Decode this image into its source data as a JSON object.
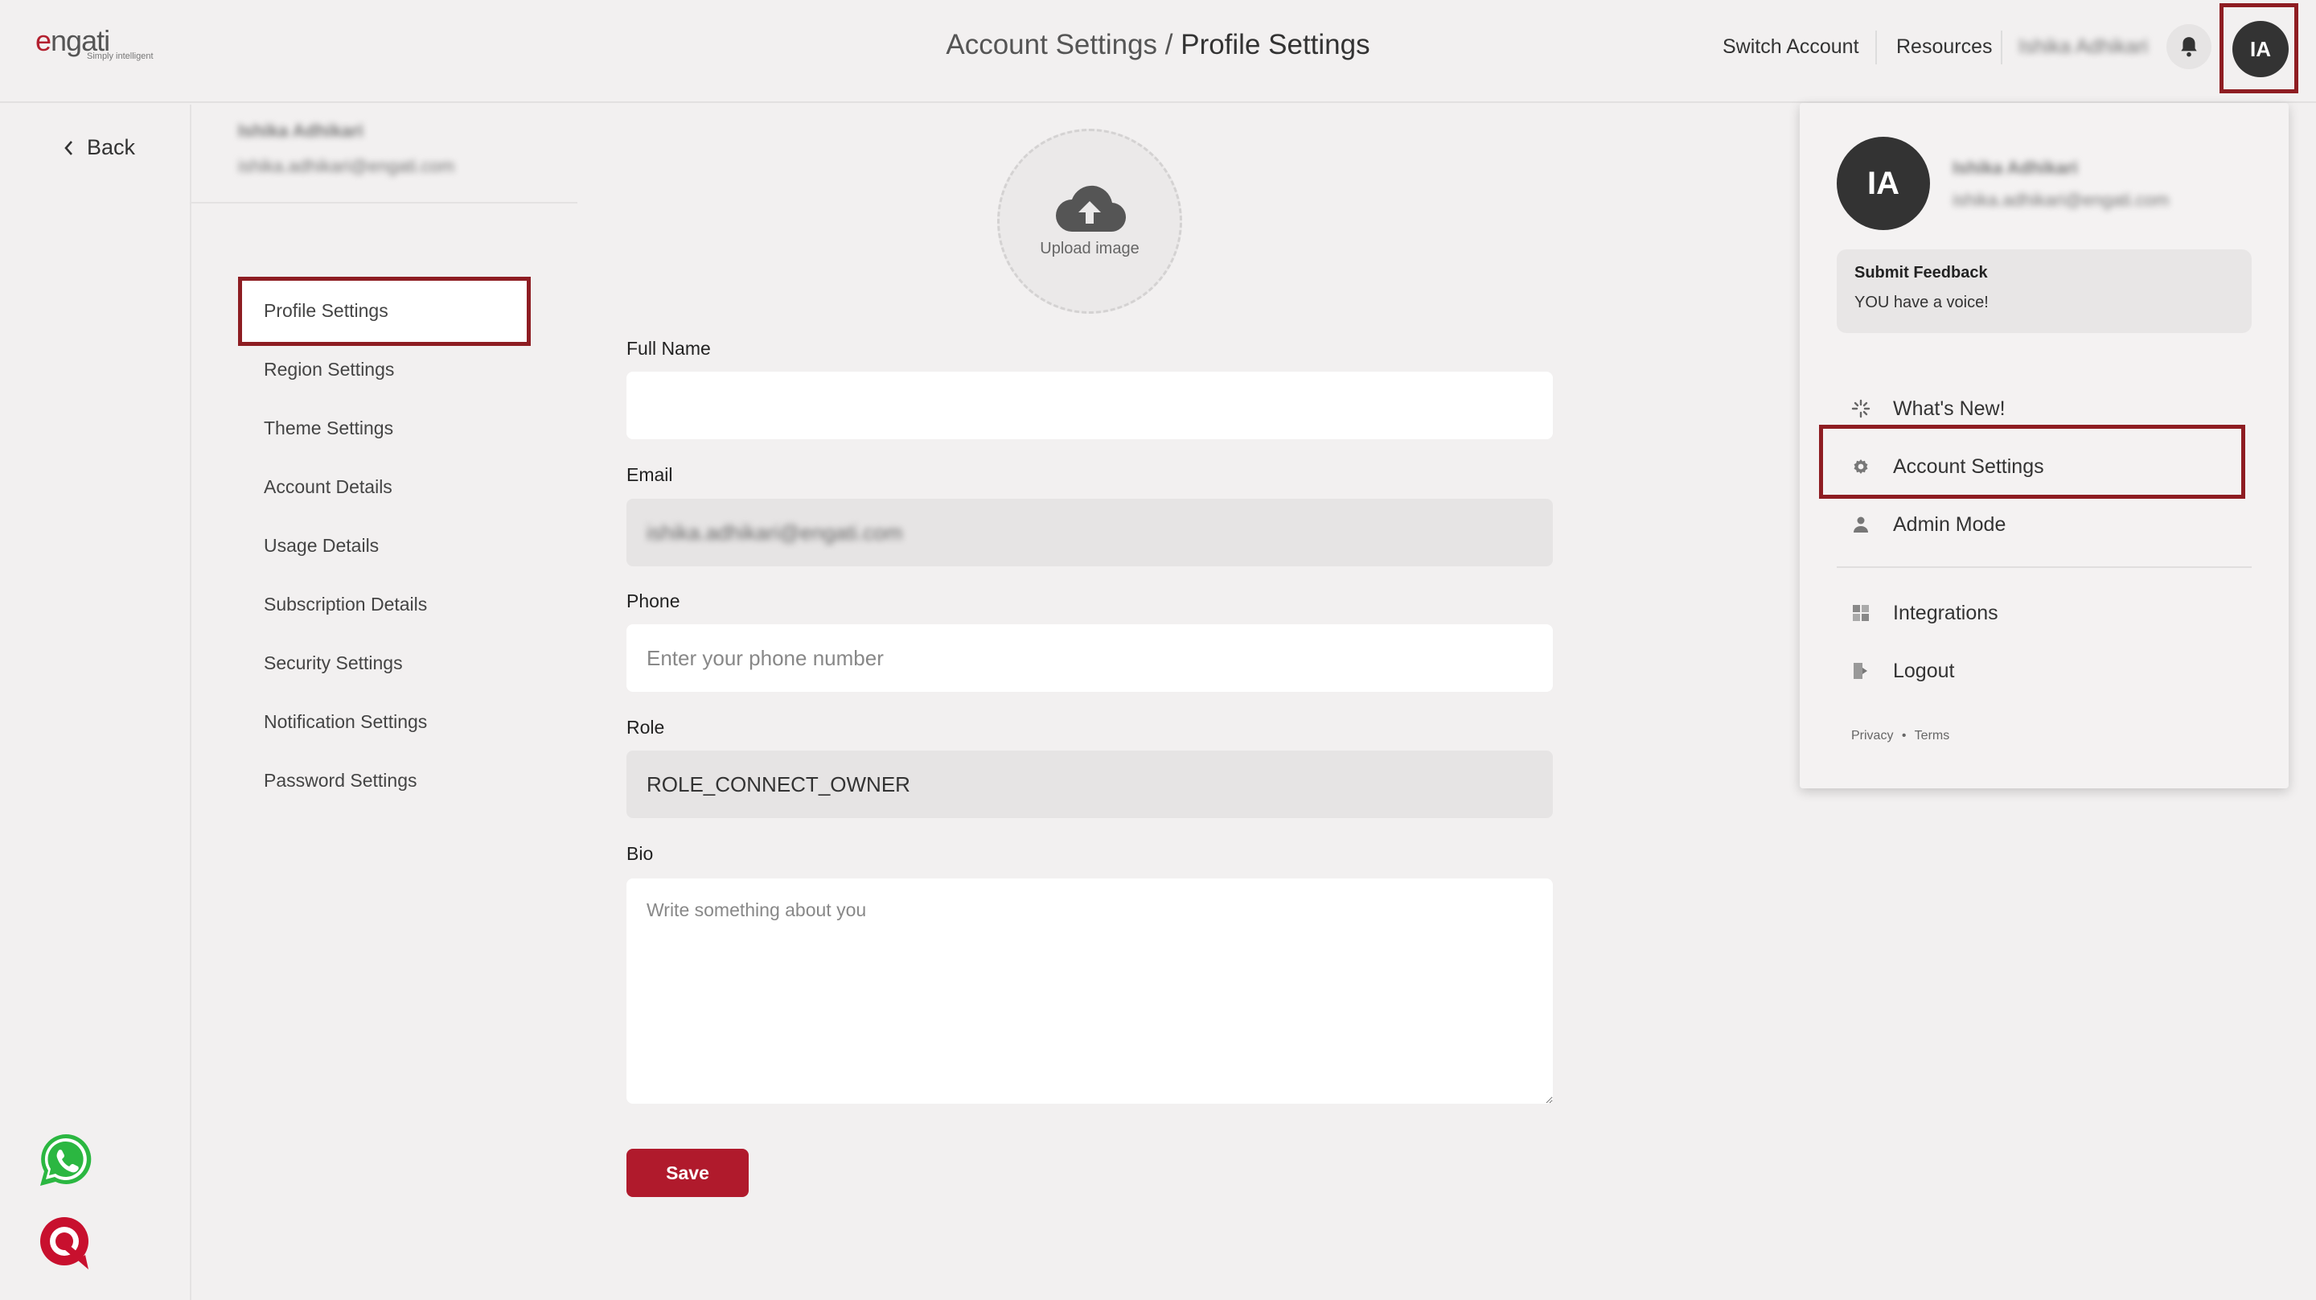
{
  "header": {
    "logo_text_a": "e",
    "logo_text_b": "ngati",
    "logo_tagline": "Simply intelligent",
    "title_parent": "Account Settings",
    "title_separator": " / ",
    "title_current": "Profile Settings",
    "switch_account": "Switch Account",
    "resources": "Resources",
    "user_name_blurred": "Ishika Adhikari",
    "avatar_initials": "IA"
  },
  "rail": {
    "back_label": "Back"
  },
  "user": {
    "name": "Ishika Adhikari",
    "email": "ishika.adhikari@engati.com"
  },
  "nav": {
    "items": [
      {
        "label": "Profile Settings"
      },
      {
        "label": "Region Settings"
      },
      {
        "label": "Theme Settings"
      },
      {
        "label": "Account Details"
      },
      {
        "label": "Usage Details"
      },
      {
        "label": "Subscription Details"
      },
      {
        "label": "Security Settings"
      },
      {
        "label": "Notification Settings"
      },
      {
        "label": "Password Settings"
      }
    ]
  },
  "form": {
    "upload_label": "Upload image",
    "full_name_label": "Full Name",
    "full_name_value": "",
    "email_label": "Email",
    "email_value": "ishika.adhikari@engati.com",
    "phone_label": "Phone",
    "phone_placeholder": "Enter your phone number",
    "role_label": "Role",
    "role_value": "ROLE_CONNECT_OWNER",
    "bio_label": "Bio",
    "bio_placeholder": "Write something about you",
    "save_label": "Save"
  },
  "dropdown": {
    "avatar_initials": "IA",
    "user_name": "Ishika Adhikari",
    "user_email": "ishika.adhikari@engati.com",
    "feedback_title": "Submit Feedback",
    "feedback_sub": "YOU have a voice!",
    "items": [
      {
        "label": "What's New!",
        "icon": "sparkle-icon"
      },
      {
        "label": "Account Settings",
        "icon": "gear-icon"
      },
      {
        "label": "Admin Mode",
        "icon": "person-icon"
      },
      {
        "label": "Integrations",
        "icon": "grid-icon"
      },
      {
        "label": "Logout",
        "icon": "logout-icon"
      }
    ],
    "privacy": "Privacy",
    "dot": "•",
    "terms": "Terms"
  },
  "colors": {
    "accent": "#b01a2c",
    "highlight": "#8e1d22",
    "dark": "#333333"
  }
}
